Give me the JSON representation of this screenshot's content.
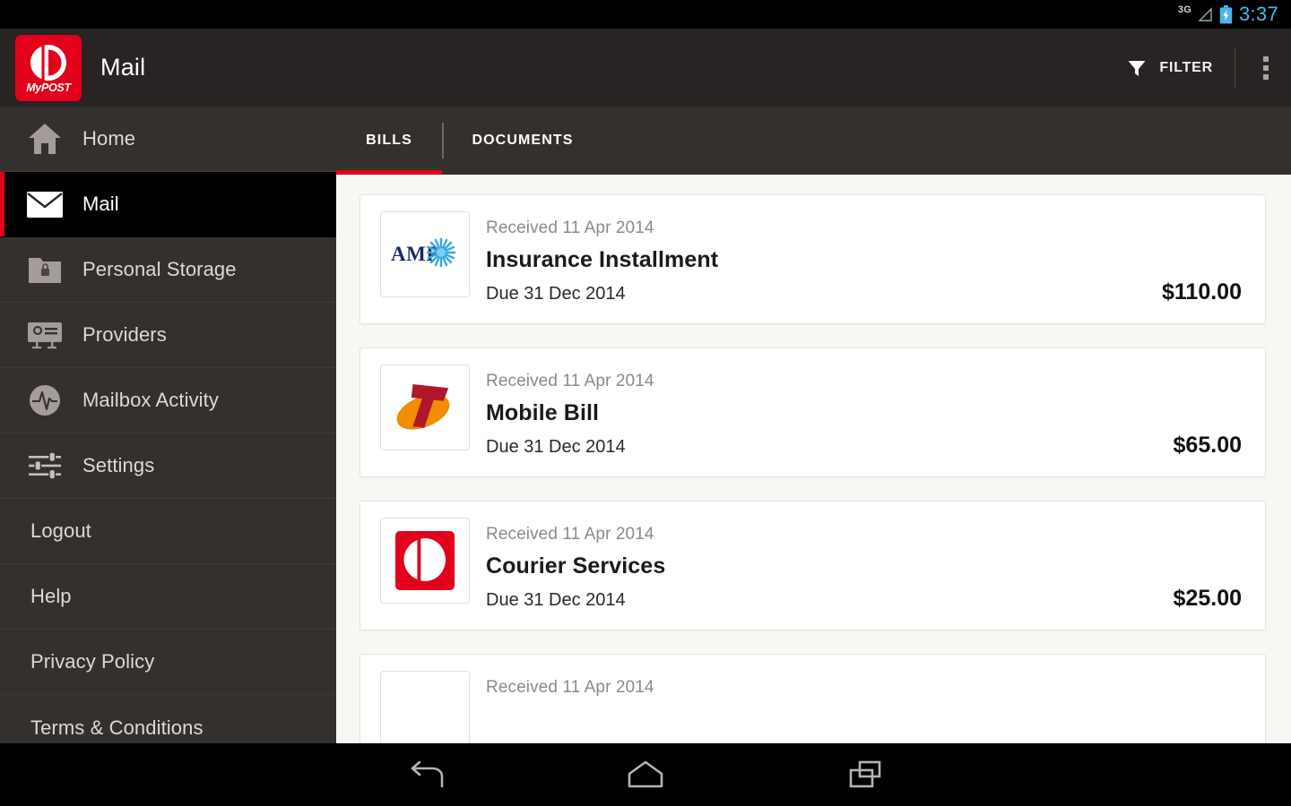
{
  "statusbar": {
    "network": "3G",
    "signal_icon": "signal-triangle-icon",
    "battery_icon": "battery-charging-icon",
    "clock": "3:37",
    "clock_color": "#49b5e8"
  },
  "actionbar": {
    "logo_name": "mypost-logo",
    "logo_word_my": "My",
    "logo_word_post": "POST",
    "title": "Mail",
    "filter_label": "FILTER",
    "filter_icon": "funnel-icon",
    "overflow_icon": "overflow-menu-icon",
    "brand_red": "#e2001a",
    "bar_bg": "#272423"
  },
  "sidebar": {
    "items": [
      {
        "label": "Home",
        "icon": "home-icon",
        "has_icon": true,
        "selected": false
      },
      {
        "label": "Mail",
        "icon": "envelope-icon",
        "has_icon": true,
        "selected": true
      },
      {
        "label": "Personal Storage",
        "icon": "locked-folder-icon",
        "has_icon": true,
        "selected": false
      },
      {
        "label": "Providers",
        "icon": "provider-card-icon",
        "has_icon": true,
        "selected": false
      },
      {
        "label": "Mailbox Activity",
        "icon": "activity-pulse-icon",
        "has_icon": true,
        "selected": false
      },
      {
        "label": "Settings",
        "icon": "sliders-icon",
        "has_icon": true,
        "selected": false
      },
      {
        "label": "Logout",
        "icon": "",
        "has_icon": false,
        "selected": false
      },
      {
        "label": "Help",
        "icon": "",
        "has_icon": false,
        "selected": false
      },
      {
        "label": "Privacy Policy",
        "icon": "",
        "has_icon": false,
        "selected": false
      },
      {
        "label": "Terms & Conditions",
        "icon": "",
        "has_icon": false,
        "selected": false
      }
    ]
  },
  "tabs": [
    {
      "label": "BILLS",
      "active": true
    },
    {
      "label": "DOCUMENTS",
      "active": false
    }
  ],
  "bills": [
    {
      "logo": "amp-logo",
      "received": "Received 11 Apr 2014",
      "title": "Insurance Installment",
      "due": "Due 31 Dec 2014",
      "amount": "$110.00"
    },
    {
      "logo": "telstra-logo",
      "received": "Received 11 Apr 2014",
      "title": "Mobile Bill",
      "due": "Due 31 Dec 2014",
      "amount": "$65.00"
    },
    {
      "logo": "auspost-logo",
      "received": "Received 11 Apr 2014",
      "title": "Courier Services",
      "due": "Due 31 Dec 2014",
      "amount": "$25.00"
    },
    {
      "logo": "",
      "received": "Received 11 Apr 2014",
      "title": "",
      "due": "",
      "amount": ""
    }
  ],
  "navbar": {
    "back_icon": "back-arrow-icon",
    "home_icon": "home-outline-icon",
    "recents_icon": "recent-apps-icon"
  }
}
